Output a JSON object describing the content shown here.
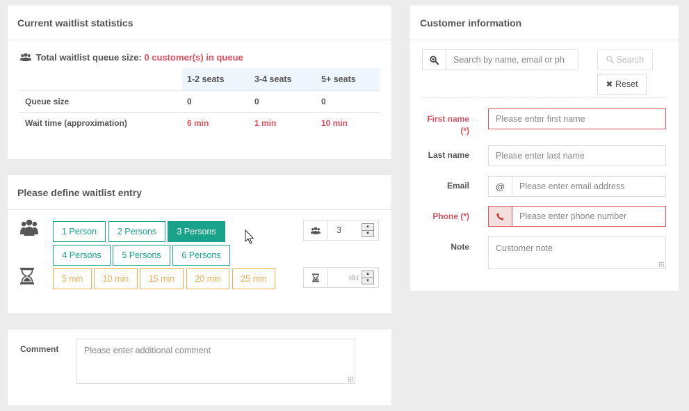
{
  "stats": {
    "title": "Current waitlist statistics",
    "queue_label": "Total waitlist queue size:",
    "queue_value": "0 customer(s) in queue",
    "columns": [
      "1-2 seats",
      "3-4 seats",
      "5+ seats"
    ],
    "rows": [
      {
        "label": "Queue size",
        "values": [
          "0",
          "0",
          "0"
        ]
      },
      {
        "label": "Wait time (approximation)",
        "values": [
          "6 min",
          "1 min",
          "10 min"
        ]
      }
    ]
  },
  "entry": {
    "title": "Please define waitlist entry",
    "persons": [
      "1 Person",
      "2 Persons",
      "3 Persons",
      "4 Persons",
      "5 Persons",
      "6 Persons"
    ],
    "selected_person": "3 Persons",
    "times": [
      "5 min",
      "10 min",
      "15 min",
      "20 min",
      "25 min"
    ],
    "persons_value": "3",
    "time_value": "ıəɹ"
  },
  "comment": {
    "label": "Comment",
    "placeholder": "Please enter additional comment"
  },
  "customer": {
    "title": "Customer information",
    "search_placeholder": "Search by name, email or ph",
    "search_button": "Search",
    "reset_button": "Reset",
    "fields": {
      "first_name": {
        "label": "First name",
        "required": "(*)",
        "placeholder": "Please enter first name"
      },
      "last_name": {
        "label": "Last name",
        "placeholder": "Please enter last name"
      },
      "email": {
        "label": "Email",
        "addon": "@",
        "placeholder": "Please enter email address"
      },
      "phone": {
        "label": "Phone (*)",
        "placeholder": "Please enter phone number"
      },
      "note": {
        "label": "Note",
        "placeholder": "Customer note"
      }
    }
  },
  "colors": {
    "accent_teal": "#1aa38a",
    "accent_orange": "#f0ac4c",
    "error_red": "#d9535f"
  },
  "icons": [
    "group-icon",
    "hourglass-icon",
    "search-plus-icon",
    "search-icon",
    "close-icon",
    "phone-icon",
    "mouse-cursor-icon"
  ]
}
